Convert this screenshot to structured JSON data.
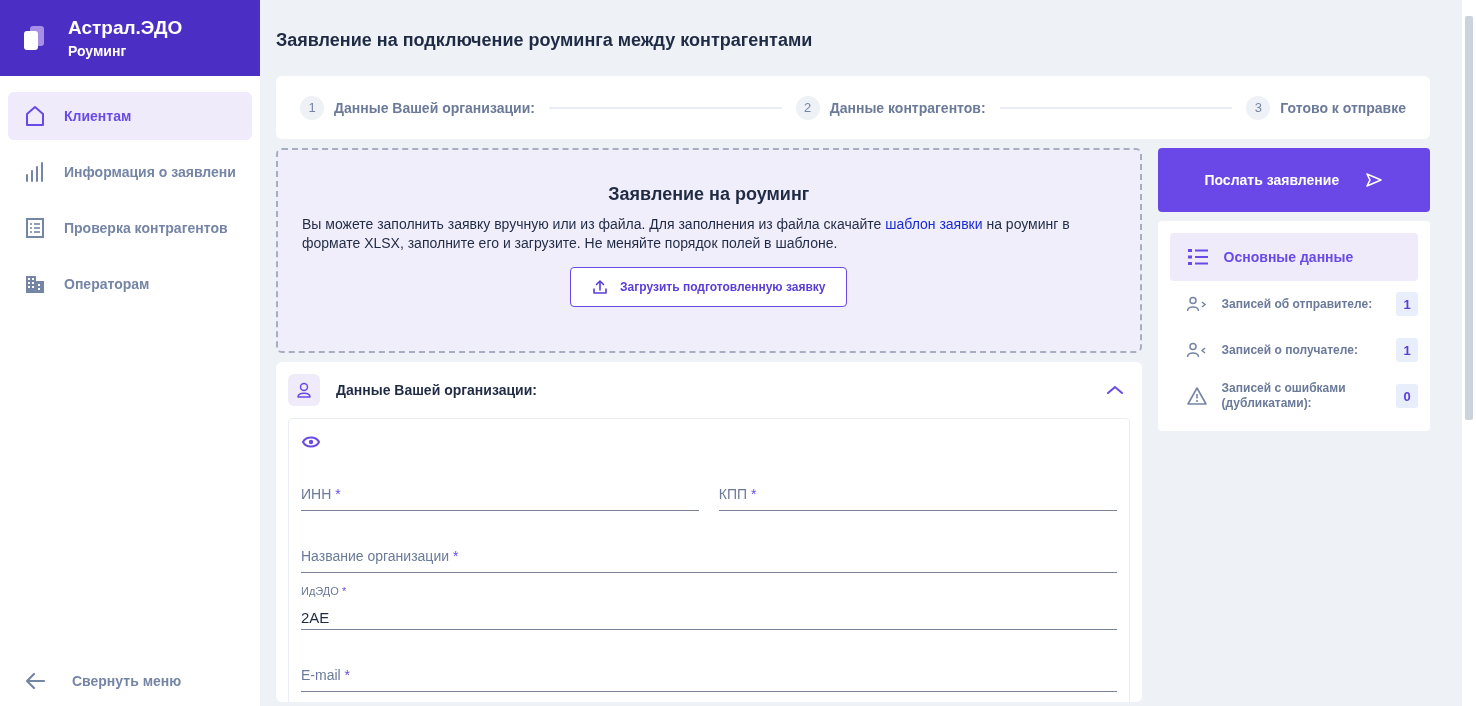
{
  "brand": {
    "name": "Астрал.ЭДО",
    "product": "Роуминг"
  },
  "sidebar": {
    "items": [
      {
        "label": "Клиентам",
        "selected": true
      },
      {
        "label": "Информация о заявлени",
        "selected": false
      },
      {
        "label": "Проверка контрагентов",
        "selected": false
      },
      {
        "label": "Операторам",
        "selected": false
      }
    ],
    "collapse": "Свернуть меню"
  },
  "page_title": "Заявление на подключение роуминга между контрагентами",
  "steps": [
    {
      "number": "1",
      "label": "Данные Вашей организации:"
    },
    {
      "number": "2",
      "label": "Данные контрагентов:"
    },
    {
      "number": "3",
      "label": "Готово к отправке"
    }
  ],
  "dropzone": {
    "title": "Заявление на роуминг",
    "text_before": "Вы можете заполнить заявку вручную или из файла. Для заполнения из файла скачайте ",
    "link": "шаблон заявки",
    "text_after": " на роуминг в формате XLSX, заполните его и загрузите. Не меняйте порядок полей в шаблоне.",
    "button": "Загрузить подготовленную заявку"
  },
  "section": {
    "title": "Данные Вашей организации:",
    "expanded": true,
    "rows": [
      [
        {
          "label": "ИНН",
          "mark": "*"
        },
        {
          "label": "КПП",
          "mark": "*"
        }
      ],
      [
        {
          "label": "Название организации",
          "mark": "*"
        }
      ],
      [
        {
          "label": "ИдЭДО",
          "mark": "*",
          "value": "2AE"
        }
      ],
      [
        {
          "label": "E-mail",
          "mark": "*"
        }
      ]
    ]
  },
  "send_button": "Послать заявление",
  "summary": {
    "nav": {
      "label": "Основные данные",
      "selected": true
    },
    "rows": [
      {
        "label": "Записей об отправителе:",
        "count": "1"
      },
      {
        "label": "Записей о получателе:",
        "count": "1"
      },
      {
        "label": "Записей с ошибками (дубликатами):",
        "count": "0"
      }
    ]
  }
}
